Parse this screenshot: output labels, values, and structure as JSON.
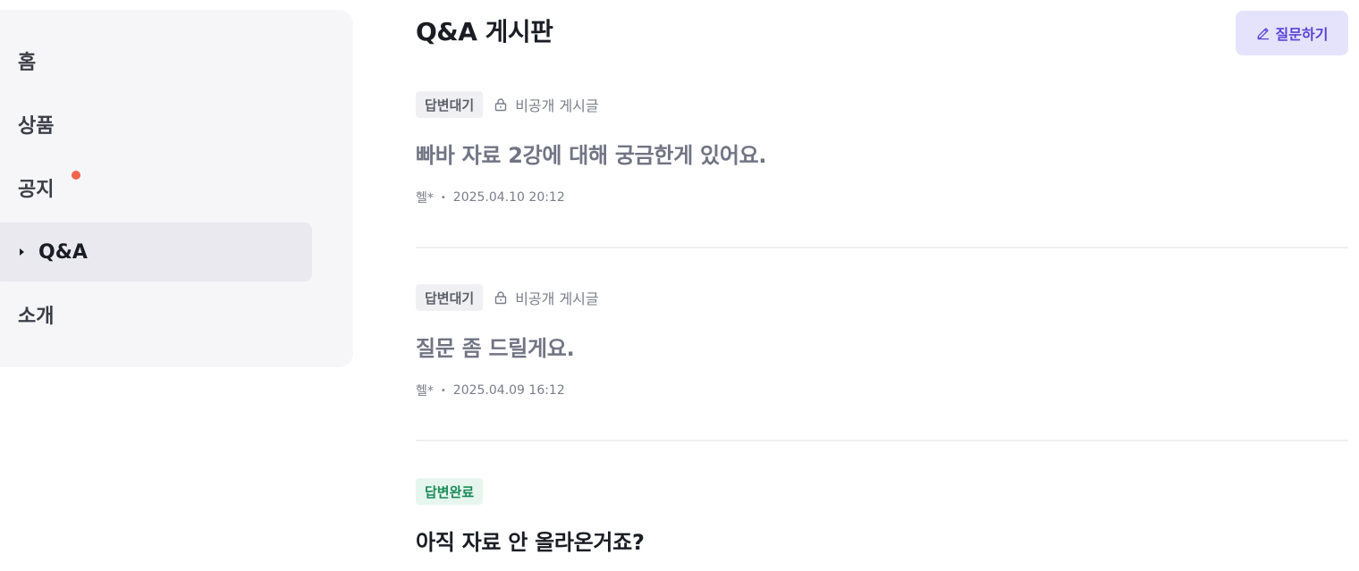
{
  "sidebar": {
    "items": [
      {
        "label": "홈",
        "active": false
      },
      {
        "label": "상품",
        "active": false
      },
      {
        "label": "공지",
        "active": false,
        "has_notification_dot": true
      },
      {
        "label": "Q&A",
        "active": true
      },
      {
        "label": "소개",
        "active": false
      }
    ]
  },
  "header": {
    "title": "Q&A 게시판",
    "ask_button_label": "질문하기",
    "ask_button_icon": "pencil-icon"
  },
  "posts": [
    {
      "status": "답변대기",
      "private_label": "비공개 게시글",
      "title": "빠바 자료 2강에 대해 궁금한게 있어요.",
      "author": "헬*",
      "datetime": "2025.04.10 20:12"
    },
    {
      "status": "답변대기",
      "private_label": "비공개 게시글",
      "title": "질문 좀 드릴게요.",
      "author": "헬*",
      "datetime": "2025.04.09 16:12"
    },
    {
      "status": "답변완료",
      "title": "아직 자료 안 올라온거죠?"
    }
  ],
  "colors": {
    "accent": "#5a44d8",
    "notification_dot": "#f0664d",
    "status_done": "#1a8a57"
  }
}
